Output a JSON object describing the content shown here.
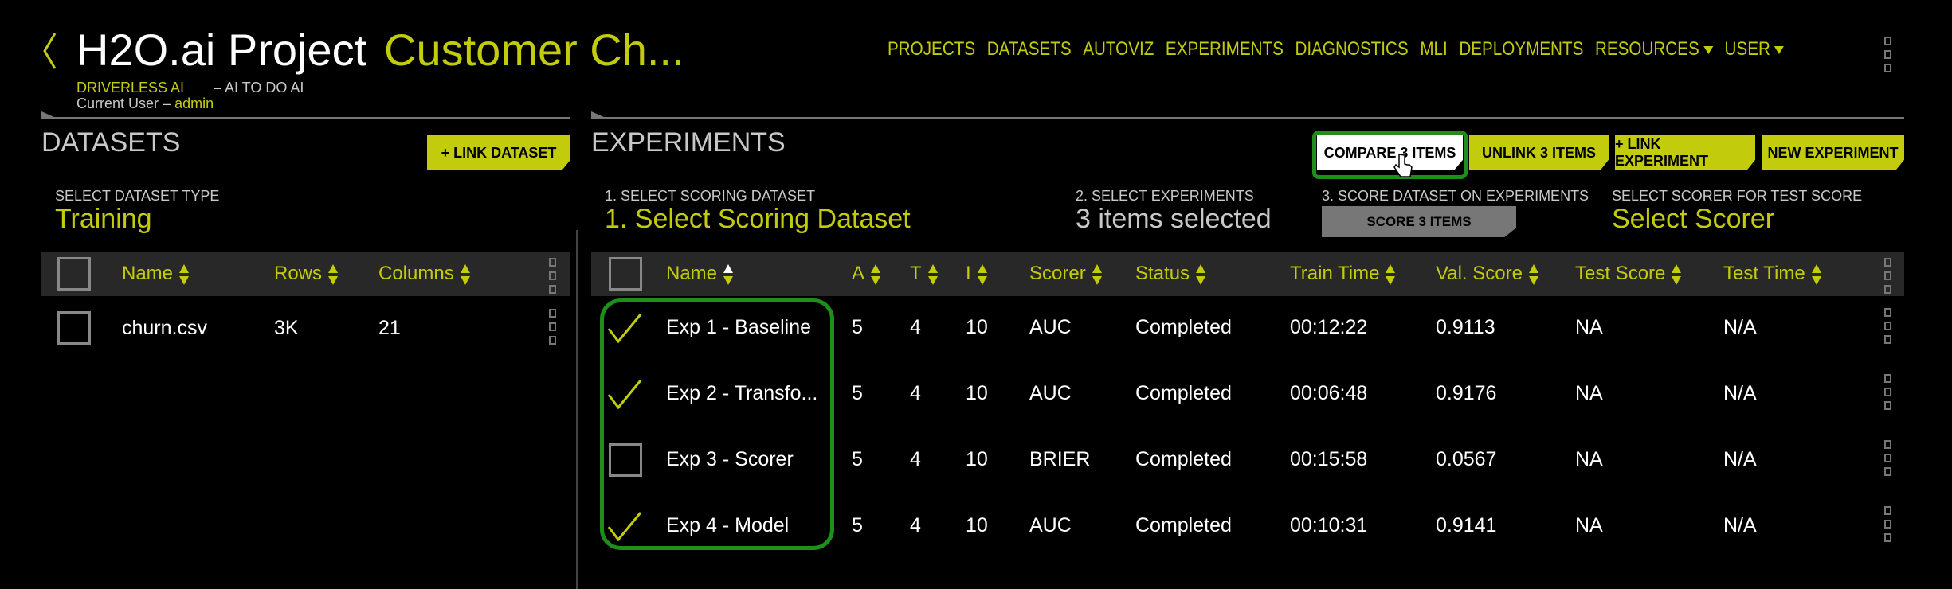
{
  "header": {
    "back_icon": "chevron-left-icon",
    "project": "H2O.ai Project",
    "name": "Customer Ch...",
    "brand": "DRIVERLESS AI",
    "tagline": "– AI TO DO AI",
    "user_label": "Current User –",
    "user": "admin"
  },
  "nav": {
    "items": [
      "PROJECTS",
      "DATASETS",
      "AUTOVIZ",
      "EXPERIMENTS",
      "DIAGNOSTICS",
      "MLI",
      "DEPLOYMENTS"
    ],
    "resources": "RESOURCES",
    "user": "USER"
  },
  "datasets": {
    "title": "DATASETS",
    "link_button": "+ LINK DATASET",
    "type_label": "SELECT DATASET TYPE",
    "type_value": "Training",
    "columns": [
      "Name",
      "Rows",
      "Columns"
    ],
    "rows": [
      {
        "name": "churn.csv",
        "rows": "3K",
        "columns": "21"
      }
    ]
  },
  "experiments": {
    "title": "EXPERIMENTS",
    "buttons": {
      "compare": "COMPARE 3 ITEMS",
      "unlink": "UNLINK 3 ITEMS",
      "link": "+ LINK EXPERIMENT",
      "new": "NEW EXPERIMENT"
    },
    "step1_label": "1. SELECT SCORING DATASET",
    "step1_value": "1. Select Scoring Dataset",
    "step2_label": "2. SELECT EXPERIMENTS",
    "step2_value": "3 items selected",
    "step3_label": "3. SCORE DATASET ON EXPERIMENTS",
    "score_button": "SCORE 3 ITEMS",
    "scorer_label": "SELECT SCORER FOR TEST SCORE",
    "scorer_value": "Select Scorer",
    "columns": [
      "Name",
      "A",
      "T",
      "I",
      "Scorer",
      "Status",
      "Train Time",
      "Val. Score",
      "Test Score",
      "Test Time"
    ],
    "rows": [
      {
        "checked": true,
        "name": "Exp 1 - Baseline",
        "a": "5",
        "t": "4",
        "i": "10",
        "scorer": "AUC",
        "status": "Completed",
        "train": "00:12:22",
        "val": "0.9113",
        "test": "NA",
        "test_time": "N/A"
      },
      {
        "checked": true,
        "name": "Exp 2 - Transfo...",
        "a": "5",
        "t": "4",
        "i": "10",
        "scorer": "AUC",
        "status": "Completed",
        "train": "00:06:48",
        "val": "0.9176",
        "test": "NA",
        "test_time": "N/A"
      },
      {
        "checked": false,
        "name": "Exp 3 - Scorer",
        "a": "5",
        "t": "4",
        "i": "10",
        "scorer": "BRIER",
        "status": "Completed",
        "train": "00:15:58",
        "val": "0.0567",
        "test": "NA",
        "test_time": "N/A"
      },
      {
        "checked": true,
        "name": "Exp 4 - Model",
        "a": "5",
        "t": "4",
        "i": "10",
        "scorer": "AUC",
        "status": "Completed",
        "train": "00:10:31",
        "val": "0.9141",
        "test": "NA",
        "test_time": "N/A"
      }
    ]
  },
  "colors": {
    "accent": "#c2cc0c",
    "highlight": "#1e8f1a",
    "header_bg": "#282828"
  }
}
